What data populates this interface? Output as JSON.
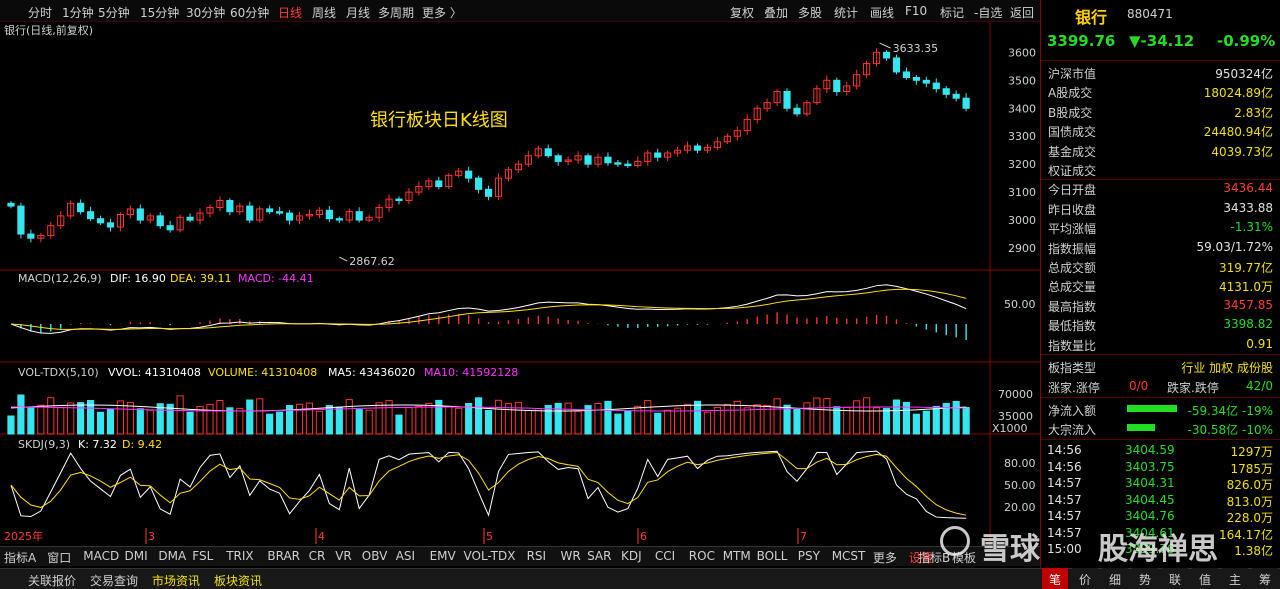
{
  "top_toolbar": {
    "periods": [
      "分时",
      "1分钟",
      "5分钟",
      "15分钟",
      "30分钟",
      "60分钟",
      "日线",
      "周线",
      "月线",
      "多周期",
      "更多 〉"
    ],
    "active_period": "日线",
    "tools": [
      "复权",
      "叠加",
      "多股",
      "统计",
      "画线",
      "F10",
      "标记",
      "-自选",
      "返回"
    ]
  },
  "main_chart": {
    "header_label": "银行(日线,前复权)",
    "title_annotation": "银行板块日K线图",
    "high_marker": "3633.35",
    "low_marker": "2867.62",
    "y_ticks": [
      "3600",
      "3500",
      "3400",
      "3300",
      "3200",
      "3100",
      "3000",
      "2900"
    ]
  },
  "macd": {
    "name": "MACD(12,26,9)",
    "dif": "DIF: 16.90",
    "dea": "DEA: 39.11",
    "macd": "MACD: -44.41",
    "y_tick": "50.00"
  },
  "volume": {
    "name": "VOL-TDX(5,10)",
    "vvol": "VVOL: 41310408",
    "volume": "VOLUME: 41310408",
    "ma5": "MA5: 43436020",
    "ma10": "MA10: 41592128",
    "y_ticks": [
      "70000",
      "35000"
    ],
    "unit": "X1000"
  },
  "skdj": {
    "name": "SKDJ(9,3)",
    "k": "K: 7.32",
    "d": "D: 9.42",
    "y_ticks": [
      "80.00",
      "50.00",
      "20.00"
    ]
  },
  "x_axis": {
    "labels": [
      "2025年",
      "3",
      "4",
      "5",
      "6",
      "7"
    ]
  },
  "indicator_tabs": [
    "指标A",
    "窗口",
    "MACD",
    "DMI",
    "DMA",
    "FSL",
    "TRIX",
    "BRAR",
    "CR",
    "VR",
    "OBV",
    "ASI",
    "EMV",
    "VOL-TDX",
    "RSI",
    "WR",
    "SAR",
    "KDJ",
    "CCI",
    "ROC",
    "MTM",
    "BOLL",
    "PSY",
    "MCST",
    "更多",
    "设置"
  ],
  "bottom_tabs_right": [
    "指标B",
    "模板"
  ],
  "status_tabs": [
    "关联报价",
    "交易查询",
    "市场资讯",
    "板块资讯"
  ],
  "quote": {
    "name": "银行",
    "code": "880471",
    "price": "3399.76",
    "change": "▼-34.12",
    "change_pct": "-0.99%",
    "stats": [
      {
        "label": "沪深市值",
        "value": "950324亿",
        "color": "#e0e0e0"
      },
      {
        "label": "A股成交",
        "value": "18024.89亿",
        "color": "#f0e000"
      },
      {
        "label": "B股成交",
        "value": "2.83亿",
        "color": "#f0e000"
      },
      {
        "label": "国债成交",
        "value": "24480.94亿",
        "color": "#f0e000"
      },
      {
        "label": "基金成交",
        "value": "4039.73亿",
        "color": "#f0e000"
      },
      {
        "label": "权证成交",
        "value": "",
        "color": "#f0e000"
      },
      {
        "label": "今日开盘",
        "value": "3436.44",
        "color": "#ff3a3a"
      },
      {
        "label": "昨日收盘",
        "value": "3433.88",
        "color": "#e0e0e0"
      },
      {
        "label": "平均涨幅",
        "value": "-1.31%",
        "color": "#22dd22"
      },
      {
        "label": "指数振幅",
        "value": "59.03/1.72%",
        "color": "#e0e0e0"
      },
      {
        "label": "总成交额",
        "value": "319.77亿",
        "color": "#f0e000"
      },
      {
        "label": "总成交量",
        "value": "4131.0万",
        "color": "#f0e000"
      },
      {
        "label": "最高指数",
        "value": "3457.85",
        "color": "#ff3a3a"
      },
      {
        "label": "最低指数",
        "value": "3398.82",
        "color": "#22dd22"
      },
      {
        "label": "指数量比",
        "value": "0.91",
        "color": "#f0e000"
      }
    ],
    "sector_type_label": "板指类型",
    "sector_type_value": "行业 加权 成份股",
    "updown_label": "涨家.涨停",
    "updown_value": "0/0",
    "downcount_label": "跌家.跌停",
    "downcount_value": "42/0",
    "net_inflow_label": "净流入额",
    "net_inflow_value": "-59.34亿 -19%",
    "big_inflow_label": "大宗流入",
    "big_inflow_value": "-30.58亿 -10%",
    "ticks": [
      {
        "time": "14:56",
        "price": "3404.59",
        "vol": "1297万"
      },
      {
        "time": "14:56",
        "price": "3403.75",
        "vol": "1785万"
      },
      {
        "time": "14:57",
        "price": "3404.31",
        "vol": "826.0万"
      },
      {
        "time": "14:57",
        "price": "3404.45",
        "vol": "813.0万"
      },
      {
        "time": "14:57",
        "price": "3404.76",
        "vol": "228.0万"
      },
      {
        "time": "14:57",
        "price": "3404.61",
        "vol": "164.17亿"
      },
      {
        "time": "15:00",
        "price": "3399.76",
        "vol": "1.38亿"
      }
    ],
    "panel_tabs": [
      "笔",
      "价",
      "细",
      "势",
      "联",
      "值",
      "主",
      "筹"
    ]
  },
  "watermarks": [
    "雪球",
    "股海禅思"
  ],
  "colors": {
    "up": "#ff3030",
    "down": "#35e6f0",
    "yellow": "#f0e000",
    "magenta": "#ff30ff",
    "white": "#ffffff",
    "accent": "#c00000"
  },
  "chart_data": {
    "type": "candlestick",
    "title": "银行板块日K线图",
    "high": 3633.35,
    "low": 2867.62,
    "ylim": [
      2850,
      3680
    ],
    "x_labels": [
      "2025年",
      "3",
      "4",
      "5",
      "6",
      "7"
    ],
    "closes": [
      3050,
      2950,
      2935,
      2945,
      2980,
      3015,
      3060,
      3030,
      3005,
      2990,
      2975,
      3020,
      3040,
      3000,
      3015,
      2980,
      2965,
      3010,
      3000,
      3025,
      3045,
      3070,
      3030,
      3050,
      3000,
      3040,
      3030,
      3025,
      3000,
      3015,
      3020,
      3035,
      3005,
      3000,
      3030,
      3000,
      3010,
      3045,
      3075,
      3070,
      3100,
      3120,
      3140,
      3120,
      3160,
      3175,
      3150,
      3110,
      3085,
      3150,
      3180,
      3200,
      3230,
      3255,
      3230,
      3210,
      3215,
      3230,
      3200,
      3225,
      3205,
      3200,
      3195,
      3210,
      3240,
      3225,
      3240,
      3250,
      3265,
      3250,
      3260,
      3280,
      3300,
      3320,
      3360,
      3400,
      3420,
      3460,
      3400,
      3380,
      3420,
      3470,
      3500,
      3460,
      3480,
      3520,
      3560,
      3600,
      3580,
      3530,
      3510,
      3500,
      3490,
      3470,
      3450,
      3436,
      3400
    ],
    "vol_ma5_end": 43436020,
    "vol_ma10_end": 41592128,
    "k_end": 7.32,
    "d_end": 9.42,
    "dif_end": 16.9,
    "dea_end": 39.11,
    "macd_end": -44.41
  }
}
